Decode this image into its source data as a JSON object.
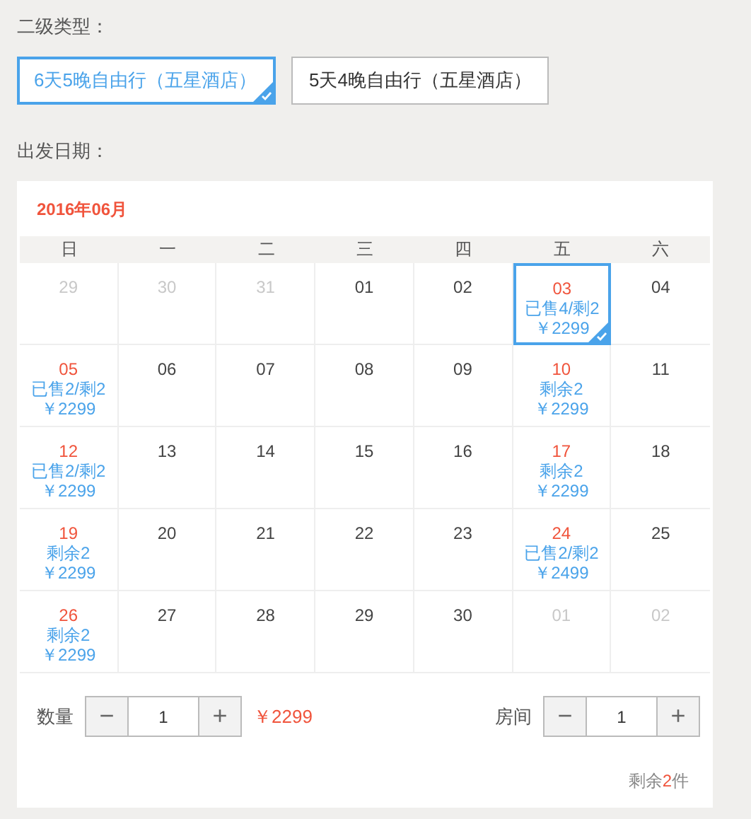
{
  "type_label": "二级类型：",
  "options": [
    {
      "label": "6天5晚自由行（五星酒店）",
      "selected": true
    },
    {
      "label": "5天4晚自由行（五星酒店）",
      "selected": false
    }
  ],
  "date_label": "出发日期：",
  "calendar": {
    "month": "2016年06月",
    "weekdays": [
      "日",
      "一",
      "二",
      "三",
      "四",
      "五",
      "六"
    ],
    "days": [
      {
        "day": "29",
        "kind": "other"
      },
      {
        "day": "30",
        "kind": "other"
      },
      {
        "day": "31",
        "kind": "other"
      },
      {
        "day": "01",
        "kind": "plain"
      },
      {
        "day": "02",
        "kind": "plain"
      },
      {
        "day": "03",
        "kind": "offer",
        "selected": true,
        "stock": "已售4/剩2",
        "price": "￥2299"
      },
      {
        "day": "04",
        "kind": "plain"
      },
      {
        "day": "05",
        "kind": "offer",
        "selected": false,
        "stock": "已售2/剩2",
        "price": "￥2299"
      },
      {
        "day": "06",
        "kind": "plain"
      },
      {
        "day": "07",
        "kind": "plain"
      },
      {
        "day": "08",
        "kind": "plain"
      },
      {
        "day": "09",
        "kind": "plain"
      },
      {
        "day": "10",
        "kind": "offer",
        "selected": false,
        "stock": "剩余2",
        "price": "￥2299"
      },
      {
        "day": "11",
        "kind": "plain"
      },
      {
        "day": "12",
        "kind": "offer",
        "selected": false,
        "stock": "已售2/剩2",
        "price": "￥2299"
      },
      {
        "day": "13",
        "kind": "plain"
      },
      {
        "day": "14",
        "kind": "plain"
      },
      {
        "day": "15",
        "kind": "plain"
      },
      {
        "day": "16",
        "kind": "plain"
      },
      {
        "day": "17",
        "kind": "offer",
        "selected": false,
        "stock": "剩余2",
        "price": "￥2299"
      },
      {
        "day": "18",
        "kind": "plain"
      },
      {
        "day": "19",
        "kind": "offer",
        "selected": false,
        "stock": "剩余2",
        "price": "￥2299"
      },
      {
        "day": "20",
        "kind": "plain"
      },
      {
        "day": "21",
        "kind": "plain"
      },
      {
        "day": "22",
        "kind": "plain"
      },
      {
        "day": "23",
        "kind": "plain"
      },
      {
        "day": "24",
        "kind": "offer",
        "selected": false,
        "stock": "已售2/剩2",
        "price": "￥2499"
      },
      {
        "day": "25",
        "kind": "plain"
      },
      {
        "day": "26",
        "kind": "offer",
        "selected": false,
        "stock": "剩余2",
        "price": "￥2299"
      },
      {
        "day": "27",
        "kind": "plain"
      },
      {
        "day": "28",
        "kind": "plain"
      },
      {
        "day": "29",
        "kind": "plain"
      },
      {
        "day": "30",
        "kind": "plain"
      },
      {
        "day": "01",
        "kind": "other"
      },
      {
        "day": "02",
        "kind": "other"
      }
    ]
  },
  "quantity": {
    "label": "数量",
    "minus": "−",
    "value": "1",
    "plus": "+",
    "price": "￥2299"
  },
  "rooms": {
    "label": "房间",
    "minus": "−",
    "value": "1",
    "plus": "+"
  },
  "stock_note": {
    "before": "剩余",
    "count": "2",
    "after": "件"
  }
}
